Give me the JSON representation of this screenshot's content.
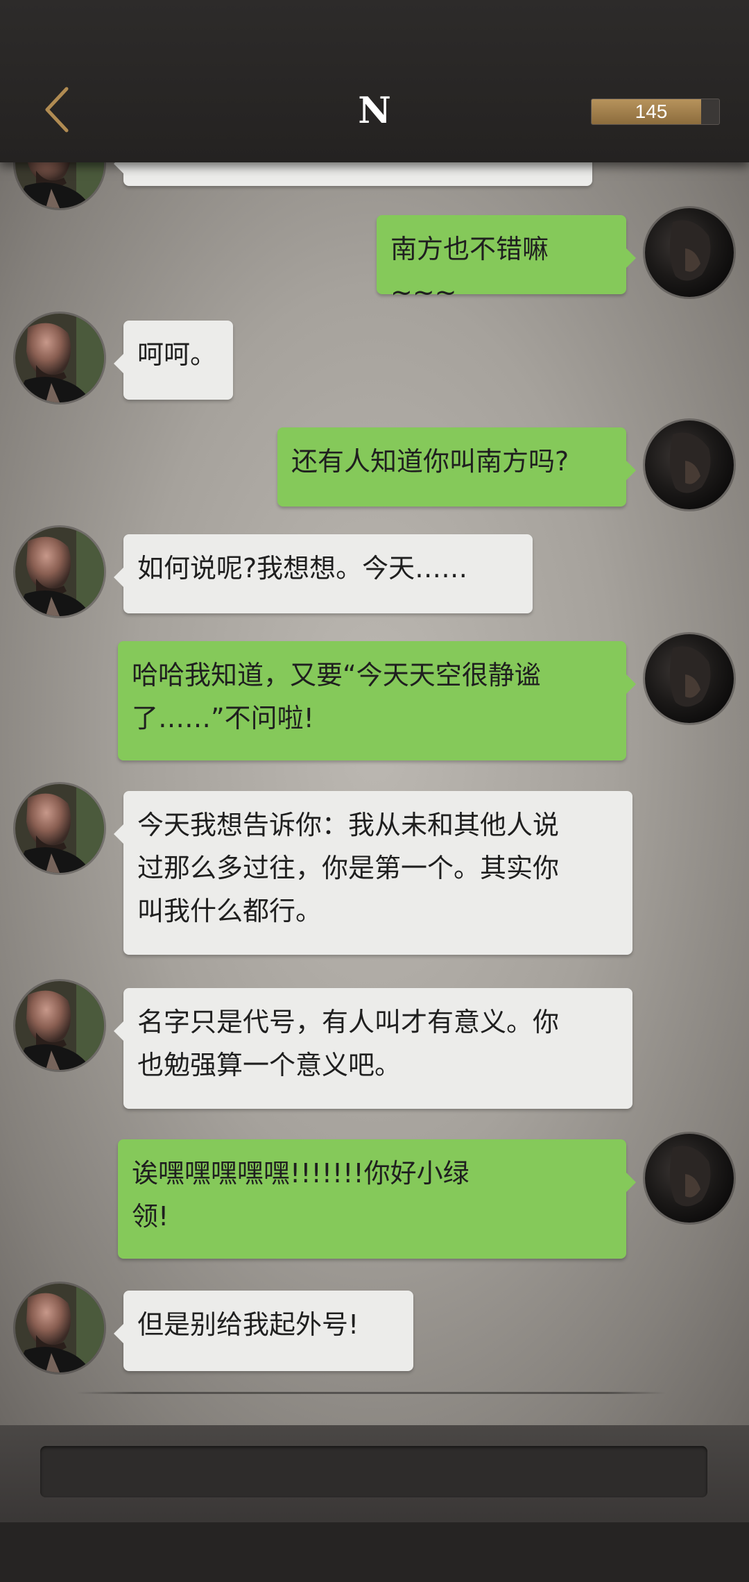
{
  "header": {
    "title": "N",
    "counter": "145",
    "counter_fraction": 0.86
  },
  "colors": {
    "bubble_green": "#85c95a",
    "bubble_white": "#ececea",
    "header_bg": "#2a2827",
    "accent_gold": "#b7935c"
  },
  "messages": [
    {
      "side": "left",
      "text": ""
    },
    {
      "side": "right",
      "text": "南方也不错嘛~~~"
    },
    {
      "side": "left",
      "text": "呵呵。"
    },
    {
      "side": "right",
      "text": "还有人知道你叫南方吗?"
    },
    {
      "side": "left",
      "text": "如何说呢?我想想。今天……"
    },
    {
      "side": "right",
      "lines": [
        "哈哈我知道，又要“今天天空很静谧",
        "了……”不问啦!"
      ]
    },
    {
      "side": "left",
      "lines": [
        "今天我想告诉你：我从未和其他人说",
        "过那么多过往，你是第一个。其实你",
        "叫我什么都行。"
      ]
    },
    {
      "side": "left",
      "lines": [
        "名字只是代号，有人叫才有意义。你",
        "也勉强算一个意义吧。"
      ]
    },
    {
      "side": "right",
      "lines": [
        "诶嘿嘿嘿嘿嘿!!!!!!!你好小绿",
        "领!"
      ]
    },
    {
      "side": "left",
      "text": "但是别给我起外号!"
    }
  ],
  "input": {
    "placeholder": ""
  }
}
